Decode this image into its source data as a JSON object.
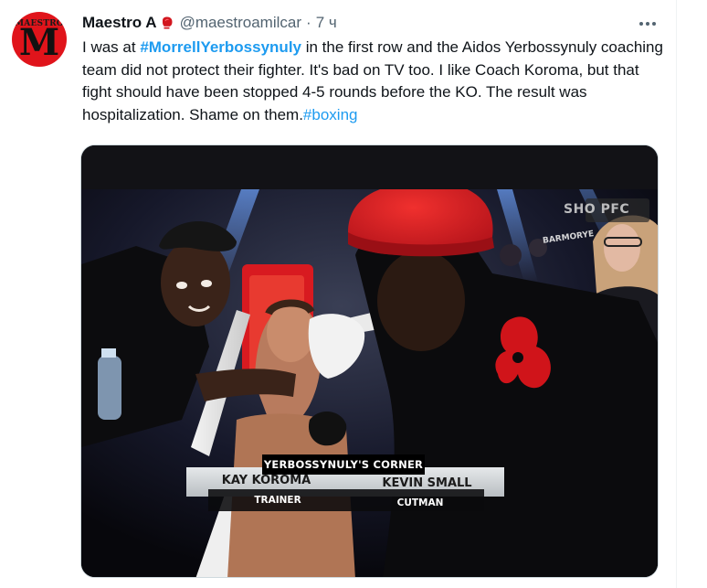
{
  "tweet": {
    "avatar_alt": "MAESTRO",
    "avatar_letter": "M",
    "display_name": "Maestro A",
    "handle": "@maestroamilcar",
    "separator": "·",
    "time": "7 ч",
    "more_icon": "more-horizontal-icon",
    "text": {
      "part1": "I was at ",
      "hashtag1": "#MorrellYerbossynuly",
      "part2": " in the first row and the Aidos Yerbossynuly coaching team did not protect their fighter. It's bad on TV too. I like Coach Koroma, but that fight should have been stopped 4-5 rounds before the KO. The result was hospitalization. Shame on them.",
      "hashtag2": "#boxing"
    },
    "colors": {
      "link": "#1d9bf0",
      "secondary": "#536471",
      "primary": "#0f1419"
    }
  },
  "media": {
    "network_logo": "SHO PFC",
    "sponsor_sign": "BARMORYE",
    "lower_third": {
      "header": "YERBOSSYNULY'S CORNER",
      "person1_name": "KAY KOROMA",
      "person1_role": "TRAINER",
      "person2_name": "KEVIN SMALL",
      "person2_role": "CUTMAN"
    }
  }
}
